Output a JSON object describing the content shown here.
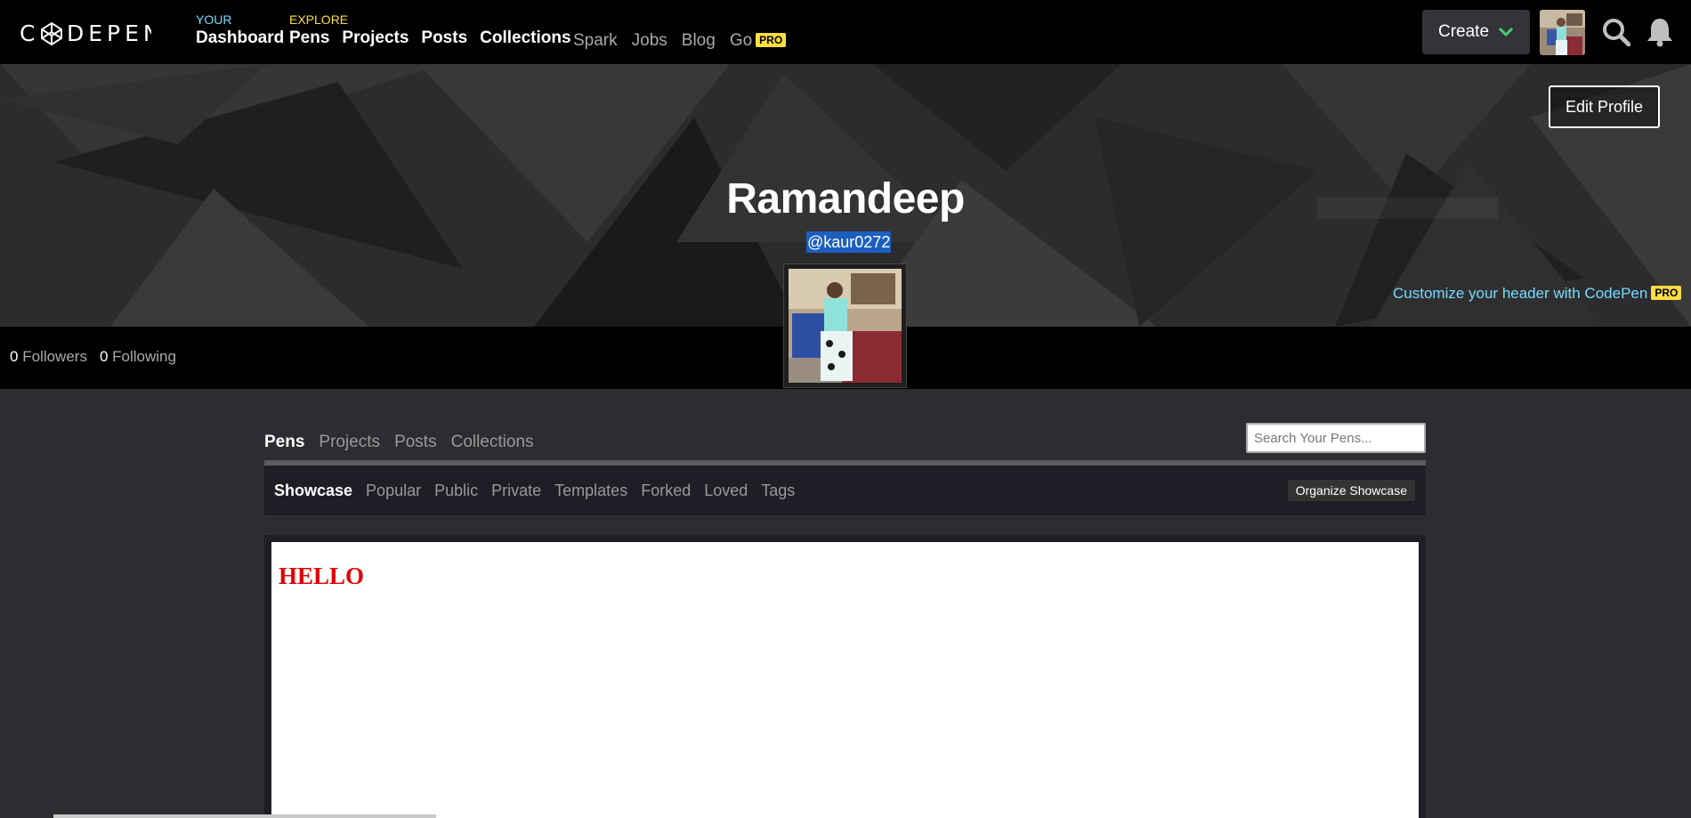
{
  "topnav": {
    "logo_text": "CODEPEN",
    "your_label": "YOUR",
    "dashboard": "Dashboard",
    "explore_label": "EXPLORE",
    "explore_links": [
      "Pens",
      "Projects",
      "Posts",
      "Collections"
    ],
    "minor_links": [
      "Spark",
      "Jobs",
      "Blog",
      "Go"
    ],
    "go_badge": "PRO",
    "create_label": "Create",
    "accent_colors": {
      "your": "#76daff",
      "explore": "#ffdd40",
      "create_chevron": "#47cf73"
    }
  },
  "profile": {
    "name": "Ramandeep",
    "handle": "@kaur0272",
    "edit_profile": "Edit Profile",
    "customize_text": "Customize your header with CodePen",
    "customize_badge": "PRO",
    "followers_count": "0",
    "followers_label": "Followers",
    "following_count": "0",
    "following_label": "Following"
  },
  "content": {
    "tabs": [
      "Pens",
      "Projects",
      "Posts",
      "Collections"
    ],
    "active_tab": "Pens",
    "search_placeholder": "Search Your Pens...",
    "subtabs": [
      "Showcase",
      "Popular",
      "Public",
      "Private",
      "Templates",
      "Forked",
      "Loved",
      "Tags"
    ],
    "active_subtab": "Showcase",
    "organize_button": "Organize Showcase",
    "pen_preview_text": "HELLO"
  }
}
